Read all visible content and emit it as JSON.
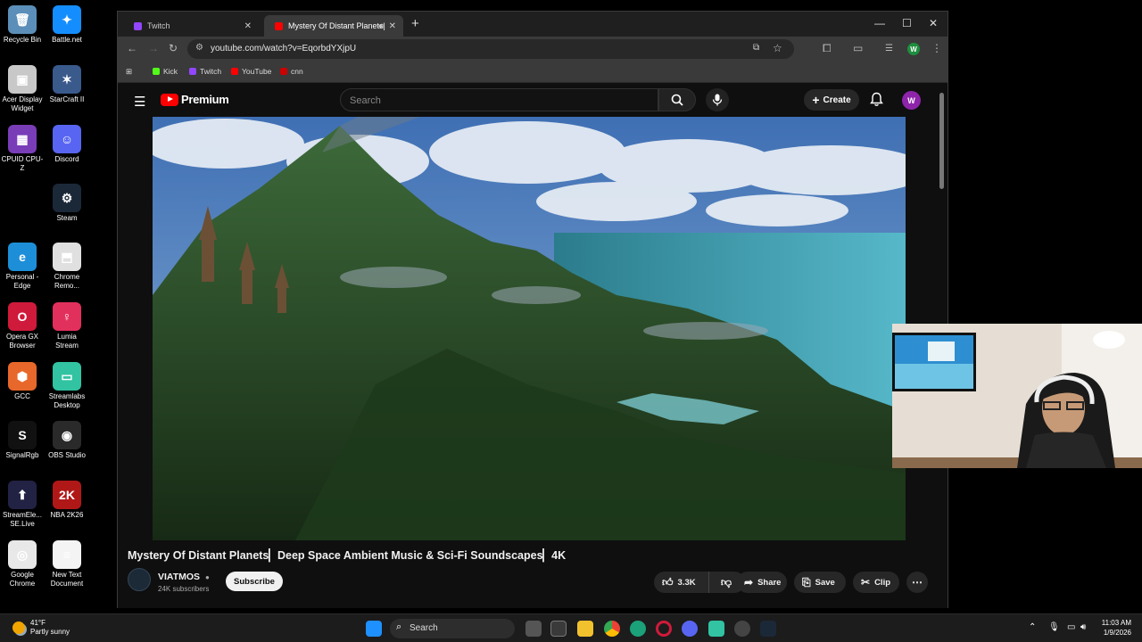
{
  "desktop_icons": [
    {
      "label": "Recycle Bin",
      "color": "#5b8fb9",
      "glyph": "🗑"
    },
    {
      "label": "Battle.net",
      "color": "#148eff",
      "glyph": "✦"
    },
    {
      "label": "Acer Display\nWidget",
      "color": "#c8c8c8",
      "glyph": "▣"
    },
    {
      "label": "StarCraft II",
      "color": "#3a5a8c",
      "glyph": "✶"
    },
    {
      "label": "CPUID CPU-Z",
      "color": "#7a3db8",
      "glyph": "▦"
    },
    {
      "label": "Discord",
      "color": "#5865f2",
      "glyph": "☺"
    },
    {
      "label": "Steam",
      "color": "#1b2838",
      "glyph": "⚙"
    },
    {
      "label": "Personal -\nEdge",
      "color": "#1d8fd8",
      "glyph": "e"
    },
    {
      "label": "Chrome\nRemo...",
      "color": "#e0e0e0",
      "glyph": "⬒"
    },
    {
      "label": "Opera GX\nBrowser",
      "color": "#d01a3b",
      "glyph": "O"
    },
    {
      "label": "Lumia\nStream",
      "color": "#e2305d",
      "glyph": "♀"
    },
    {
      "label": "GCC",
      "color": "#e8672a",
      "glyph": "⬢"
    },
    {
      "label": "Streamlabs\nDesktop",
      "color": "#31c3a2",
      "glyph": "▭"
    },
    {
      "label": "SignalRgb",
      "color": "#111111",
      "glyph": "S"
    },
    {
      "label": "OBS Studio",
      "color": "#2a2a2a",
      "glyph": "◉"
    },
    {
      "label": "StreamEle...\nSE.Live",
      "color": "#222244",
      "glyph": "⬆"
    },
    {
      "label": "NBA 2K26",
      "color": "#b01818",
      "glyph": "2K"
    },
    {
      "label": "Google\nChrome",
      "color": "#e8e8e8",
      "glyph": "◎"
    },
    {
      "label": "New Text\nDocument",
      "color": "#f4f4f4",
      "glyph": "≡"
    }
  ],
  "browser": {
    "tabs": [
      {
        "title": "Twitch",
        "favicon_color": "#9146ff"
      },
      {
        "title": "Mystery Of Distant Planets|",
        "favicon_color": "#ff0000"
      }
    ],
    "new_tab": "+",
    "url": "youtube.com/watch?v=EqorbdYXjpU",
    "profile_initial": "W",
    "bookmarks": [
      {
        "label": "Kick",
        "color": "#53fc18"
      },
      {
        "label": "Twitch",
        "color": "#9146ff"
      },
      {
        "label": "YouTube",
        "color": "#ff0000"
      },
      {
        "label": "cnn",
        "color": "#cc0000"
      }
    ]
  },
  "youtube": {
    "logo_text": "Premium",
    "search_placeholder": "Search",
    "create_label": "Create",
    "avatar_initial": "W",
    "video_title": "Mystery Of Distant Planets▏Deep Space Ambient Music & Sci-Fi Soundscapes▏4K",
    "channel_name": "VIATMOS",
    "subscribers": "24K subscribers",
    "subscribe_label": "Subscribe",
    "like_count": "3.3K",
    "share_label": "Share",
    "save_label": "Save",
    "clip_label": "Clip"
  },
  "taskbar": {
    "weather_temp": "41°F",
    "weather_desc": "Partly sunny",
    "search_label": "Search",
    "time": "11:03 AM",
    "date": "1/9/2026"
  }
}
